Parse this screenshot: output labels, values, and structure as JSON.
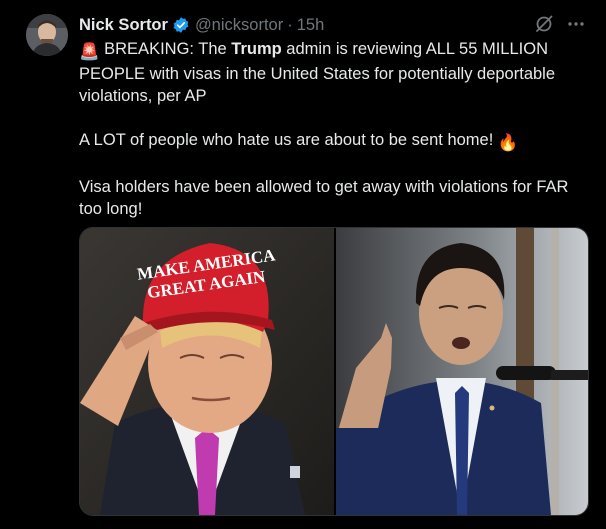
{
  "post": {
    "author_name": "Nick Sortor",
    "author_handle": "@nicksortor",
    "separator": "·",
    "time": "15h",
    "siren_emoji": "🚨",
    "line1_prefix": " BREAKING: The ",
    "line1_bold": "Trump",
    "line1_suffix": " admin is reviewing ALL 55 MILLION PEOPLE with visas in the United States for potentially deportable violations, per AP",
    "para2": "A LOT of people who hate us are about to be sent home! ",
    "fire_emoji": "🔥",
    "para3": "Visa holders have been allowed to get away with violations for FAR too long!"
  },
  "media": {
    "hat_line1": "MAKE AMERICA",
    "hat_line2": "GREAT AGAIN"
  },
  "colors": {
    "background": "#000000",
    "text": "#e7e9ea",
    "muted": "#71767b",
    "verified": "#1d9bf0",
    "hat_red": "#d21f2b"
  }
}
